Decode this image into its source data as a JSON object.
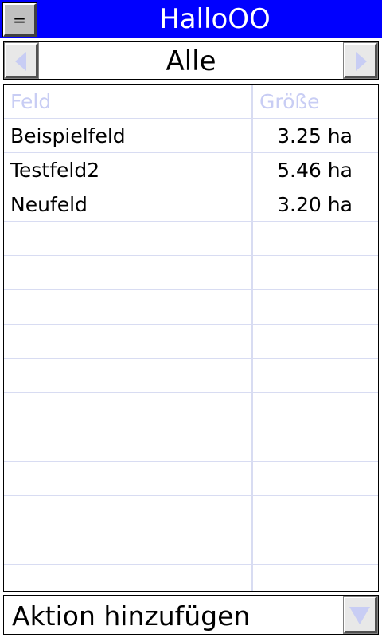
{
  "header": {
    "menu_label": "=",
    "title": "HalloOO"
  },
  "selector": {
    "current": "Alle",
    "prev_icon": "chevron-left-icon",
    "next_icon": "chevron-right-icon"
  },
  "table": {
    "columns": [
      "Feld",
      "Größe"
    ],
    "rows": [
      {
        "name": "Beispielfeld",
        "size": "3.25 ha"
      },
      {
        "name": "Testfeld2",
        "size": "5.46 ha"
      },
      {
        "name": "Neufeld",
        "size": "3.20 ha"
      }
    ],
    "empty_rows": 11
  },
  "action": {
    "label": "Aktion hinzufügen",
    "dropdown_icon": "chevron-down-icon"
  },
  "colors": {
    "titlebar": "#0000ff",
    "accent_light": "#c8cdf4",
    "grid": "#d8dcf2"
  }
}
